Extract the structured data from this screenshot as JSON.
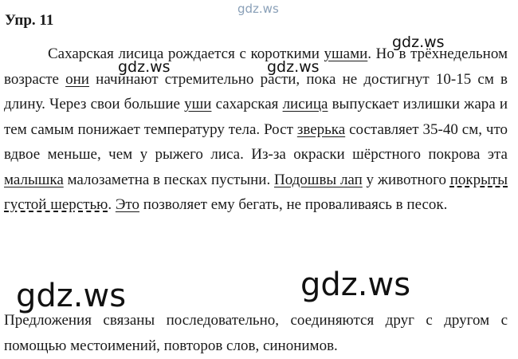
{
  "watermarks": {
    "top": "gdz.ws",
    "w1": "gdz.ws",
    "w2": "gdz.ws",
    "w3": "gdz.ws",
    "big1": "gdz.ws",
    "big2": "gdz.ws"
  },
  "title": "Упр. 11",
  "main_text": {
    "s1_a": "Сахарская лисица рождается с короткими ",
    "s1_ushami": "ушами",
    "s1_b": ". Но в трёхнедельном возрасте ",
    "s1_oni": "они",
    "s1_c": " начинают стремительно расти, пока не достигнут 10-15 см в длину. Через свои большие ",
    "s2_ushi": "уши",
    "s2_a": " сахарская ",
    "s2_lisitsa": "лисица",
    "s2_b": " выпускает излишки жара и тем самым понижает температуру тела. Рост ",
    "s3_zverka": "зверька",
    "s3_a": " составляет 35-40 см, что вдвое меньше, чем у рыжего лиса. Из-за окраски шёрстного покрова эта ",
    "s4_malyshka": "малышка",
    "s4_a": " малозаметна в песках пустыни. ",
    "s5_podoshvy": "Подошвы лап",
    "s5_a": " у животного ",
    "s5_pokryty": "покрыты густой шерстью",
    "s5_b": ". ",
    "s6_eto": "Это",
    "s6_a": " позволяет ему бегать, не проваливаясь в песок."
  },
  "conclusion": "Предложения связаны последовательно, соединяются друг с другом с помощью местоимений, повторов слов, синонимов."
}
